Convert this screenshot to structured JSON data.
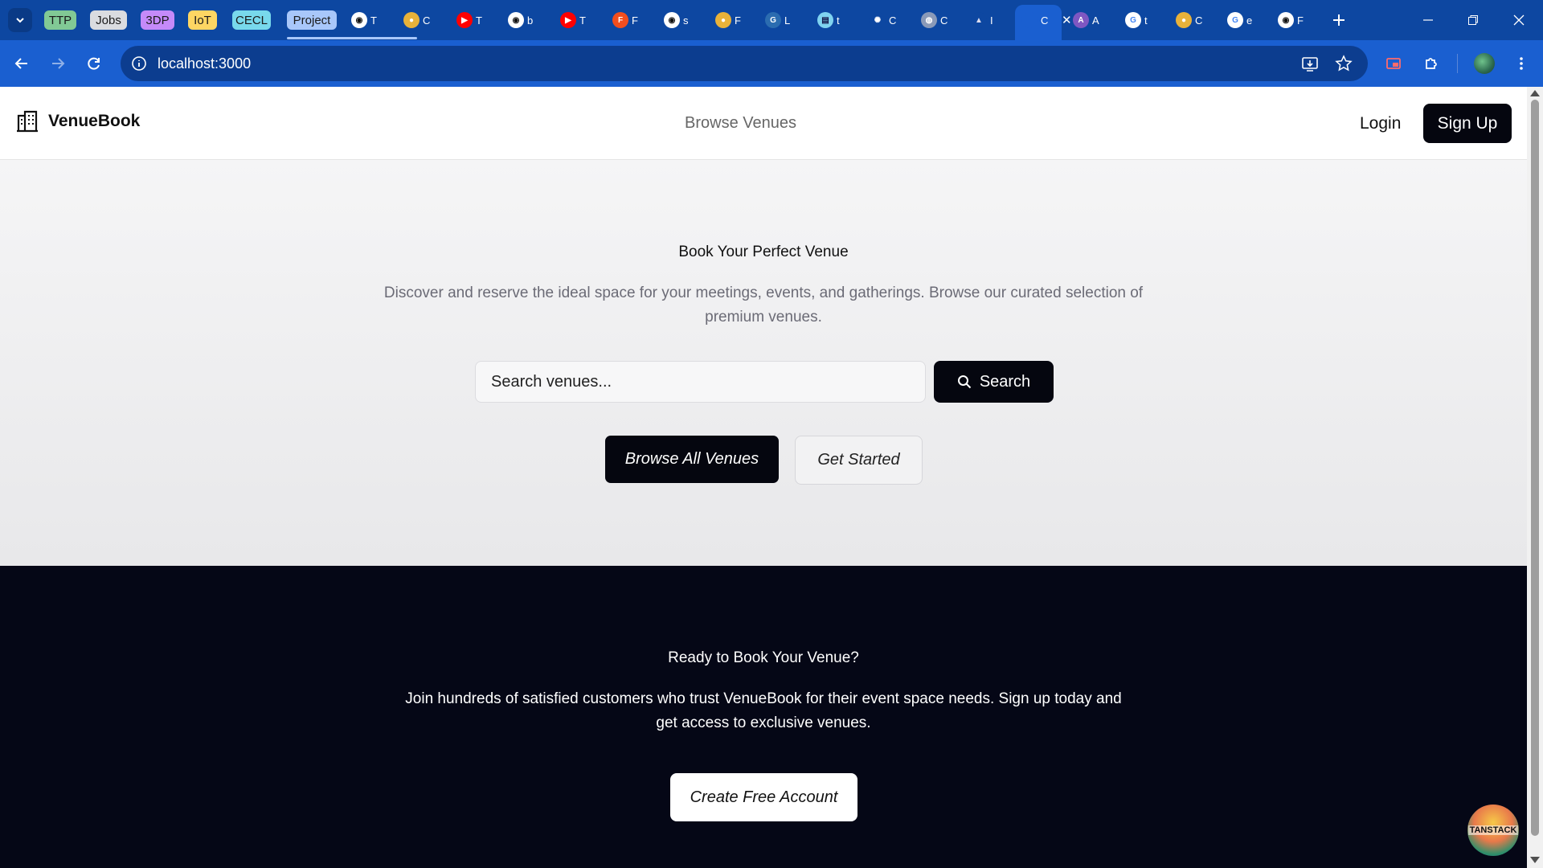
{
  "browser": {
    "tab_groups": [
      {
        "label": "TTP",
        "color": "#81c995"
      },
      {
        "label": "Jobs",
        "color": "#dadce0"
      },
      {
        "label": "3DP",
        "color": "#c58af9"
      },
      {
        "label": "IoT",
        "color": "#fdd663"
      },
      {
        "label": "CECL",
        "color": "#78d9ec"
      },
      {
        "label": "Project",
        "color": "#a8c7fa"
      }
    ],
    "tabs": [
      {
        "icon": "github-icon",
        "letter": "T"
      },
      {
        "icon": "chrome-app-icon",
        "letter": "C"
      },
      {
        "icon": "youtube-icon",
        "letter": "T"
      },
      {
        "icon": "github-icon",
        "letter": "b"
      },
      {
        "icon": "youtube-icon",
        "letter": "T"
      },
      {
        "icon": "figma-icon",
        "letter": "F"
      },
      {
        "icon": "github-icon",
        "letter": "s"
      },
      {
        "icon": "chrome-app-icon",
        "letter": "F"
      },
      {
        "icon": "gorm-icon",
        "letter": "L"
      },
      {
        "icon": "docs-icon",
        "letter": "t"
      },
      {
        "icon": "openai-icon",
        "letter": "C"
      },
      {
        "icon": "globe-icon",
        "letter": "C"
      },
      {
        "icon": "mountains-icon",
        "letter": "I"
      },
      {
        "icon": "page-icon",
        "letter": "C",
        "active": true
      },
      {
        "icon": "app-a-icon",
        "letter": "A"
      },
      {
        "icon": "google-icon",
        "letter": "t"
      },
      {
        "icon": "chrome-app-icon",
        "letter": "C"
      },
      {
        "icon": "google-icon",
        "letter": "e"
      },
      {
        "icon": "github-icon",
        "letter": "F"
      }
    ],
    "url": "localhost:3000",
    "accent": "#1a5fd0"
  },
  "nav": {
    "brand": "VenueBook",
    "browse": "Browse Venues",
    "login": "Login",
    "signup": "Sign Up"
  },
  "hero": {
    "title": "Book Your Perfect Venue",
    "description": "Discover and reserve the ideal space for your meetings, events, and gatherings. Browse our curated selection of premium venues.",
    "search_placeholder": "Search venues...",
    "search_button": "Search",
    "browse_all": "Browse All Venues",
    "get_started": "Get Started"
  },
  "cta": {
    "title": "Ready to Book Your Venue?",
    "description": "Join hundreds of satisfied customers who trust VenueBook for their event space needs. Sign up today and get access to exclusive venues.",
    "button": "Create Free Account"
  },
  "devtools": {
    "label": "TANSTACK"
  }
}
